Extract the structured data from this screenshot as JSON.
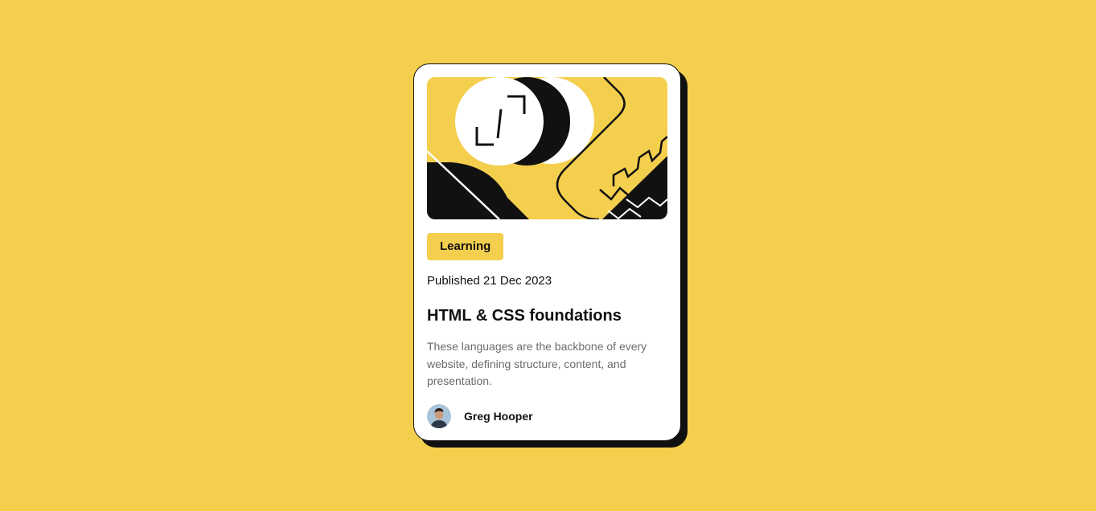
{
  "colors": {
    "background": "#F4CF4E",
    "card": "#FFFFFF",
    "ink": "#111111",
    "muted": "#6B6B6B",
    "accent": "#F4CF4E"
  },
  "card": {
    "illustration": "abstract-shapes-illustration",
    "tag": "Learning",
    "published": "Published 21 Dec 2023",
    "title": "HTML & CSS foundations",
    "description": "These languages are the backbone of every website, defining structure, content, and presentation.",
    "author": {
      "name": "Greg Hooper",
      "avatar_icon": "avatar-portrait"
    }
  }
}
